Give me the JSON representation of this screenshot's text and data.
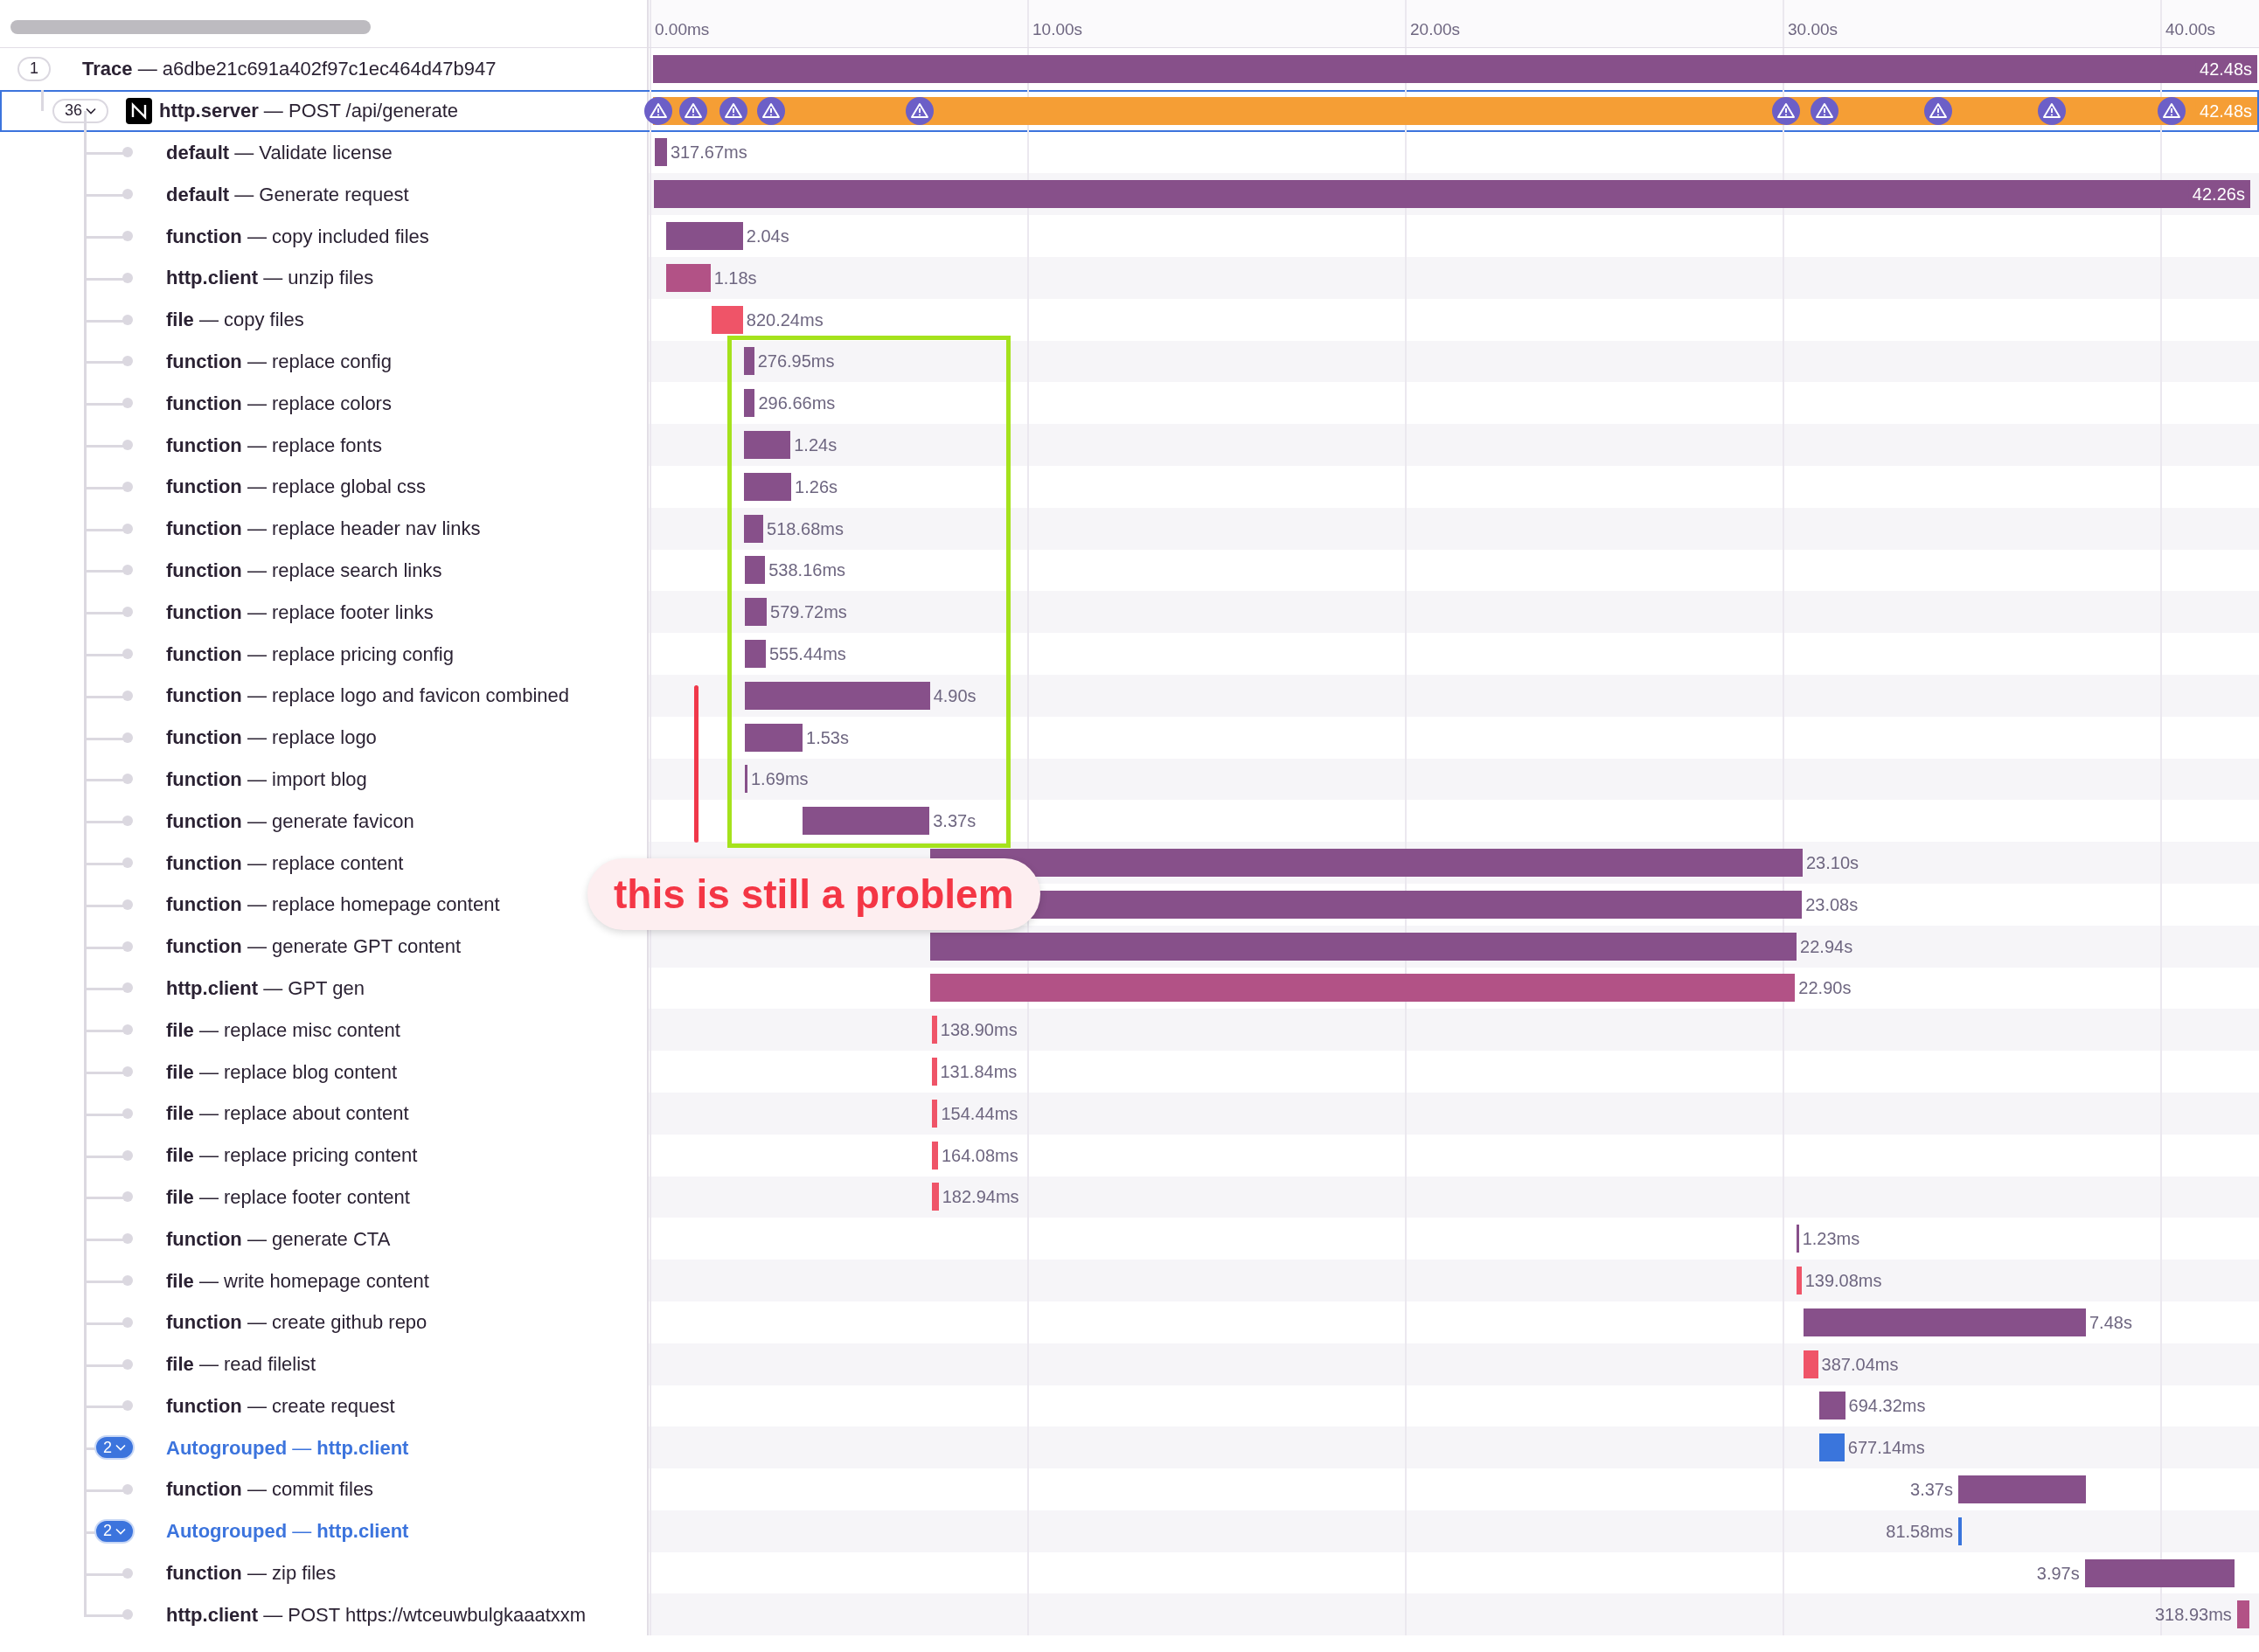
{
  "ticks": [
    "0.00ms",
    "10.00s",
    "20.00s",
    "30.00s",
    "40.00s"
  ],
  "annotation": {
    "text": "this is still a problem"
  },
  "rows": [
    {
      "count": "1",
      "label": "**Trace** — a6dbe21c691a402f97c1ec464d47b947",
      "duration": "42.48s",
      "kind": "inside",
      "color": "#87508a",
      "selected": false,
      "children": [
        {
          "count": "36",
          "logo": true,
          "label": "**http.server** — POST /api/generate",
          "duration": "42.48s",
          "kind": "inside",
          "color": "#f59e35",
          "selected": true,
          "warnings": [
            {
              "kind": "warning"
            },
            {
              "kind": "warning"
            },
            {
              "kind": "warning"
            },
            {
              "kind": "warning"
            },
            {
              "kind": "warning"
            },
            {
              "kind": "warning"
            },
            {
              "kind": "warning"
            },
            {
              "kind": "warning"
            },
            {
              "kind": "warning"
            },
            {
              "kind": "warning"
            }
          ],
          "children": [
            {
              "label": "**default** — Validate license",
              "duration": "317.67ms",
              "kind": "right",
              "color": "#87508a",
              "selected": false
            },
            {
              "label": "**default** — Generate request",
              "duration": "42.26s",
              "kind": "inside",
              "color": "#87508a",
              "selected": false
            },
            {
              "label": "**function** — copy included files",
              "duration": "2.04s",
              "kind": "right",
              "color": "#87508a",
              "selected": false
            },
            {
              "label": "**http.client** — unzip files",
              "duration": "1.18s",
              "kind": "right",
              "color": "#b25286",
              "selected": false
            },
            {
              "label": "**file** — copy files",
              "duration": "820.24ms",
              "kind": "right",
              "color": "#ef5468",
              "selected": false
            },
            {
              "label": "**function** — replace config",
              "duration": "276.95ms",
              "kind": "right",
              "color": "#87508a",
              "selected": false
            },
            {
              "label": "**function** — replace colors",
              "duration": "296.66ms",
              "kind": "right",
              "color": "#87508a",
              "selected": false
            },
            {
              "label": "**function** — replace fonts",
              "duration": "1.24s",
              "kind": "right",
              "color": "#87508a",
              "selected": false
            },
            {
              "label": "**function** — replace global css",
              "duration": "1.26s",
              "kind": "right",
              "color": "#87508a",
              "selected": false
            },
            {
              "label": "**function** — replace header nav links",
              "duration": "518.68ms",
              "kind": "right",
              "color": "#87508a",
              "selected": false
            },
            {
              "label": "**function** — replace search links",
              "duration": "538.16ms",
              "kind": "right",
              "color": "#87508a",
              "selected": false
            },
            {
              "label": "**function** — replace footer links",
              "duration": "579.72ms",
              "kind": "right",
              "color": "#87508a",
              "selected": false
            },
            {
              "label": "**function** — replace pricing config",
              "duration": "555.44ms",
              "kind": "right",
              "color": "#87508a",
              "selected": false
            },
            {
              "label": "**function** — replace logo and favicon combined",
              "duration": "4.90s",
              "kind": "right",
              "color": "#87508a",
              "selected": false
            },
            {
              "label": "**function** — replace logo",
              "duration": "1.53s",
              "kind": "right",
              "color": "#87508a",
              "selected": false
            },
            {
              "label": "**function** — import blog",
              "duration": "1.69ms",
              "kind": "right",
              "color": "#87508a",
              "selected": false
            },
            {
              "label": "**function** — generate favicon",
              "duration": "3.37s",
              "kind": "right",
              "color": "#87508a",
              "selected": false
            },
            {
              "label": "**function** — replace content",
              "duration": "23.10s",
              "kind": "right",
              "color": "#87508a",
              "selected": false
            },
            {
              "label": "**function** — replace homepage content",
              "duration": "23.08s",
              "kind": "right",
              "color": "#87508a",
              "selected": false
            },
            {
              "label": "**function** — generate GPT content",
              "duration": "22.94s",
              "kind": "right",
              "color": "#87508a",
              "selected": false
            },
            {
              "label": "**http.client** — GPT gen",
              "duration": "22.90s",
              "kind": "right",
              "color": "#b25286",
              "selected": false
            },
            {
              "label": "**file** — replace misc content",
              "duration": "138.90ms",
              "kind": "right",
              "color": "#ef5468",
              "selected": false
            },
            {
              "label": "**file** — replace blog content",
              "duration": "131.84ms",
              "kind": "right",
              "color": "#ef5468",
              "selected": false
            },
            {
              "label": "**file** — replace about content",
              "duration": "154.44ms",
              "kind": "right",
              "color": "#ef5468",
              "selected": false
            },
            {
              "label": "**file** — replace pricing content",
              "duration": "164.08ms",
              "kind": "right",
              "color": "#ef5468",
              "selected": false
            },
            {
              "label": "**file** — replace footer content",
              "duration": "182.94ms",
              "kind": "right",
              "color": "#ef5468",
              "selected": false
            },
            {
              "label": "**function** — generate CTA",
              "duration": "1.23ms",
              "kind": "right",
              "color": "#87508a",
              "selected": false
            },
            {
              "label": "**file** — write homepage content",
              "duration": "139.08ms",
              "kind": "right",
              "color": "#ef5468",
              "selected": false
            },
            {
              "label": "**function** — create github repo",
              "duration": "7.48s",
              "kind": "right",
              "color": "#87508a",
              "selected": false
            },
            {
              "label": "**file** — read filelist",
              "duration": "387.04ms",
              "kind": "right",
              "color": "#ef5468",
              "selected": false
            },
            {
              "label": "**function** — create request",
              "duration": "694.32ms",
              "kind": "right",
              "color": "#87508a",
              "selected": false
            },
            {
              "count": "2",
              "autogrouped": true,
              "label": "**Autogrouped** — **http.client**",
              "duration": "677.14ms",
              "kind": "right",
              "color": "#3a75dc",
              "selected": false
            },
            {
              "label": "**function** — commit files",
              "duration": "3.37s",
              "kind": "left",
              "color": "#87508a",
              "selected": false
            },
            {
              "count": "2",
              "autogrouped": true,
              "label": "**Autogrouped** — **http.client**",
              "duration": "81.58ms",
              "kind": "left",
              "color": "#3a75dc",
              "selected": false
            },
            {
              "label": "**function** — zip files",
              "duration": "3.97s",
              "kind": "left",
              "color": "#87508a",
              "selected": false
            },
            {
              "label": "**http.client** — POST https://wtceuwbulgkaaatxxm",
              "duration": "318.93ms",
              "kind": "left",
              "color": "#b25286",
              "selected": false
            }
          ]
        }
      ]
    }
  ]
}
